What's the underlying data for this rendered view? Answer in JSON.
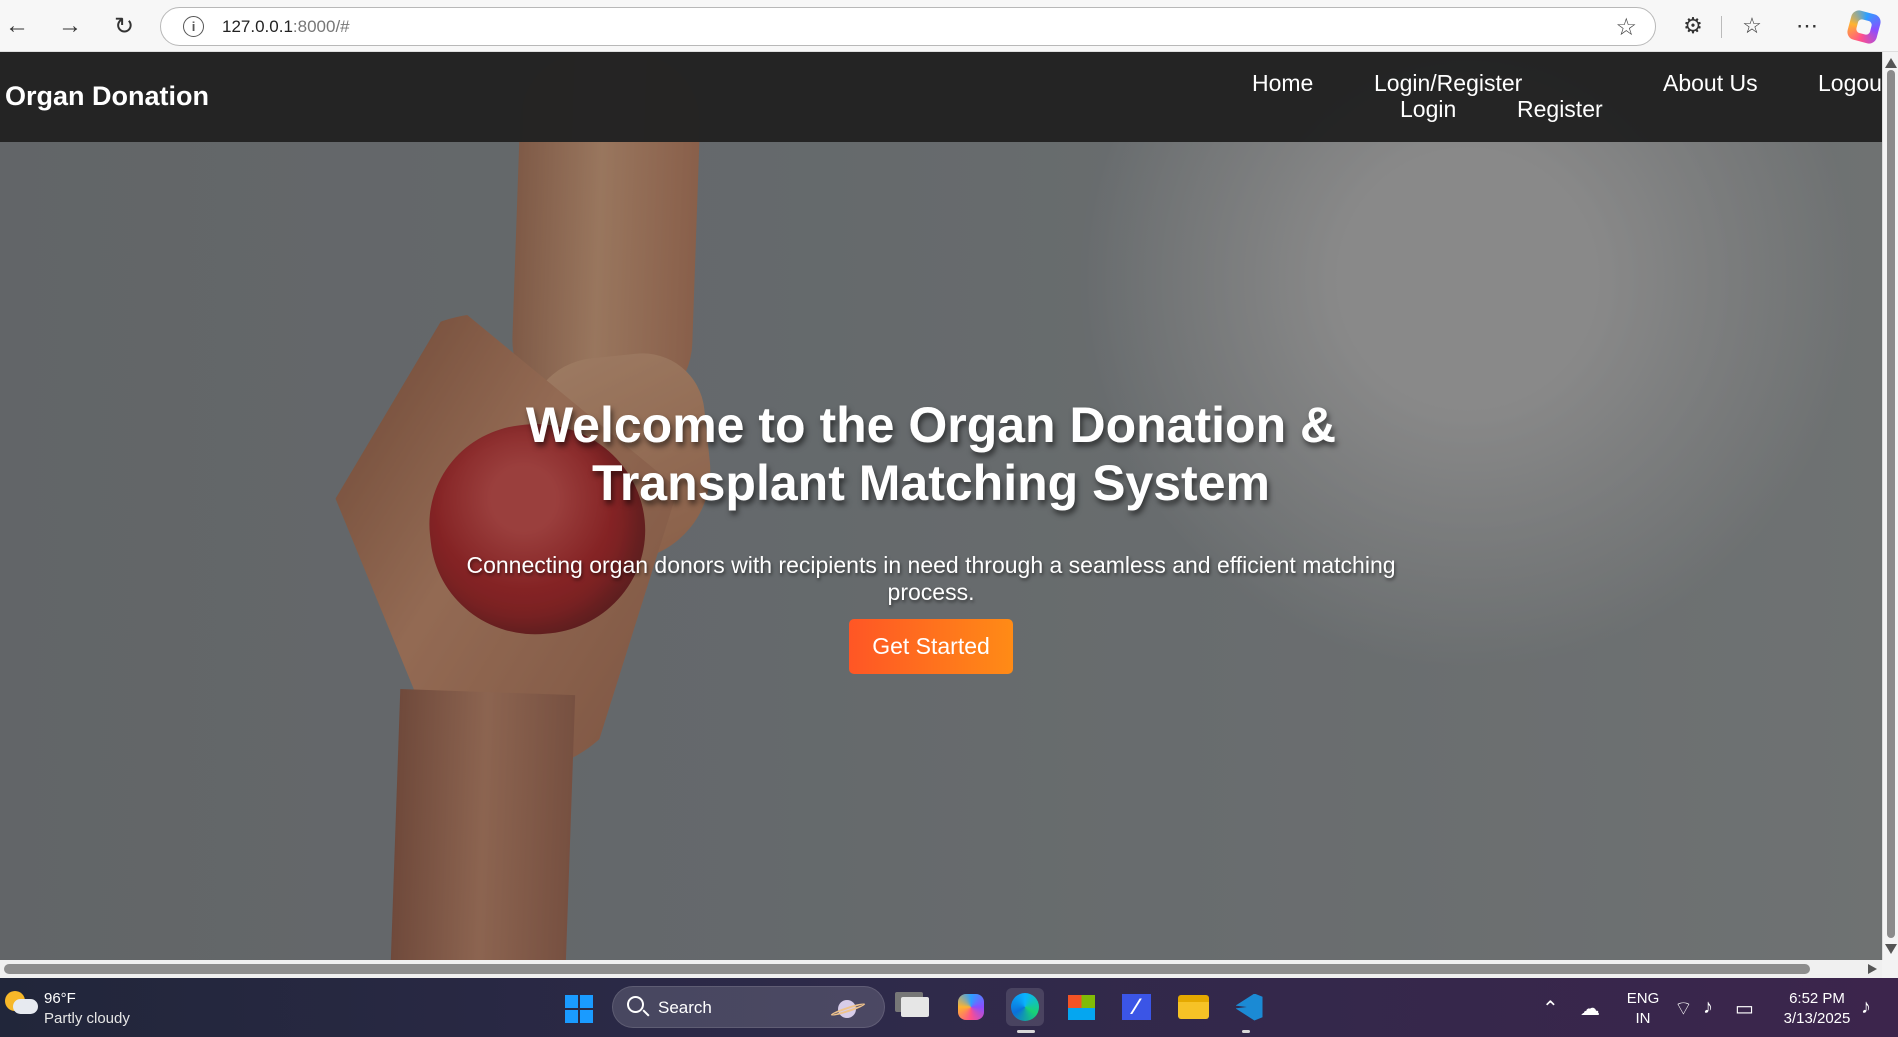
{
  "browser": {
    "url_host": "127.0.0.1",
    "url_rest": ":8000/#",
    "back_icon": "←",
    "forward_icon": "→",
    "refresh_icon": "↻",
    "info_icon": "i",
    "favorite_icon": "☆",
    "extensions_icon": "⚙",
    "favorites_icon": "☆",
    "more_icon": "⋯"
  },
  "site": {
    "brand": "Organ Donation",
    "nav": {
      "home": "Home",
      "login_register": "Login/Register",
      "login": "Login",
      "register": "Register",
      "about": "About Us",
      "logout": "Logout"
    },
    "hero": {
      "title": "Welcome to the Organ Donation & Transplant Matching System",
      "subtitle": "Connecting organ donors with recipients in need through a seamless and efficient matching process.",
      "button": "Get Started"
    }
  },
  "taskbar": {
    "weather": {
      "temperature": "96°F",
      "description": "Partly cloudy"
    },
    "search": {
      "label": "Search"
    },
    "tray": {
      "language_top": "ENG",
      "language_bottom": "IN",
      "time": "6:52 PM",
      "date": "3/13/2025"
    }
  }
}
